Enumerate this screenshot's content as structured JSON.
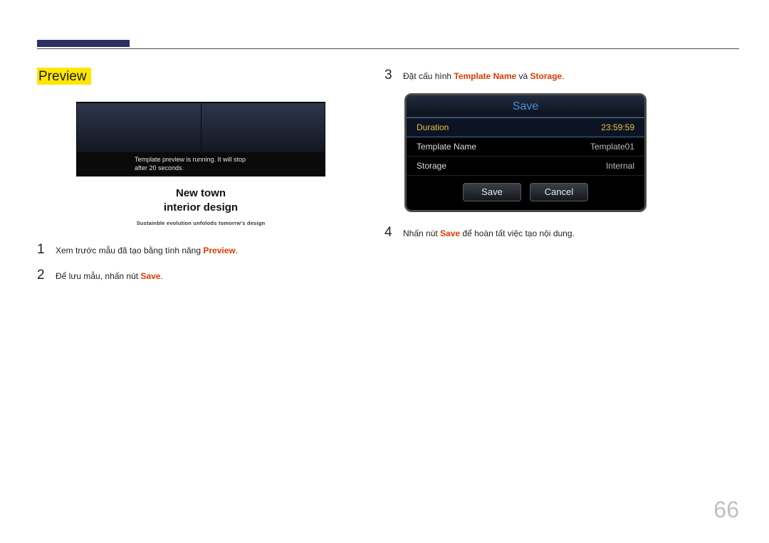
{
  "section": {
    "heading": "Preview"
  },
  "figure": {
    "msg_line1": "Template preview is running. It will stop",
    "msg_line2": "after 20 seconds.",
    "caption_l1": "New town",
    "caption_l2": "interior design",
    "subcaption": "Sustainble evolution unfolods tomorrw's design"
  },
  "steps_left": [
    {
      "num": "1",
      "pre": "Xem trước mẫu đã tạo bằng tính năng ",
      "hl": "Preview",
      "post": "."
    },
    {
      "num": "2",
      "pre": "Để lưu mẫu, nhấn nút ",
      "hl": "Save",
      "post": "."
    }
  ],
  "steps_right": [
    {
      "num": "3",
      "pre": "Đặt cấu hình ",
      "hl": "Template Name",
      "mid": " và ",
      "hl2": "Storage",
      "post": "."
    },
    {
      "num": "4",
      "pre": "Nhấn nút ",
      "hl": "Save",
      "post": " để hoàn tất việc tạo nội dung."
    }
  ],
  "dialog": {
    "title": "Save",
    "rows": [
      {
        "label": "Duration",
        "value": "23:59:59",
        "selected": true
      },
      {
        "label": "Template Name",
        "value": "Template01",
        "selected": false
      },
      {
        "label": "Storage",
        "value": "Internal",
        "selected": false
      }
    ],
    "save": "Save",
    "cancel": "Cancel"
  },
  "page_number": "66"
}
